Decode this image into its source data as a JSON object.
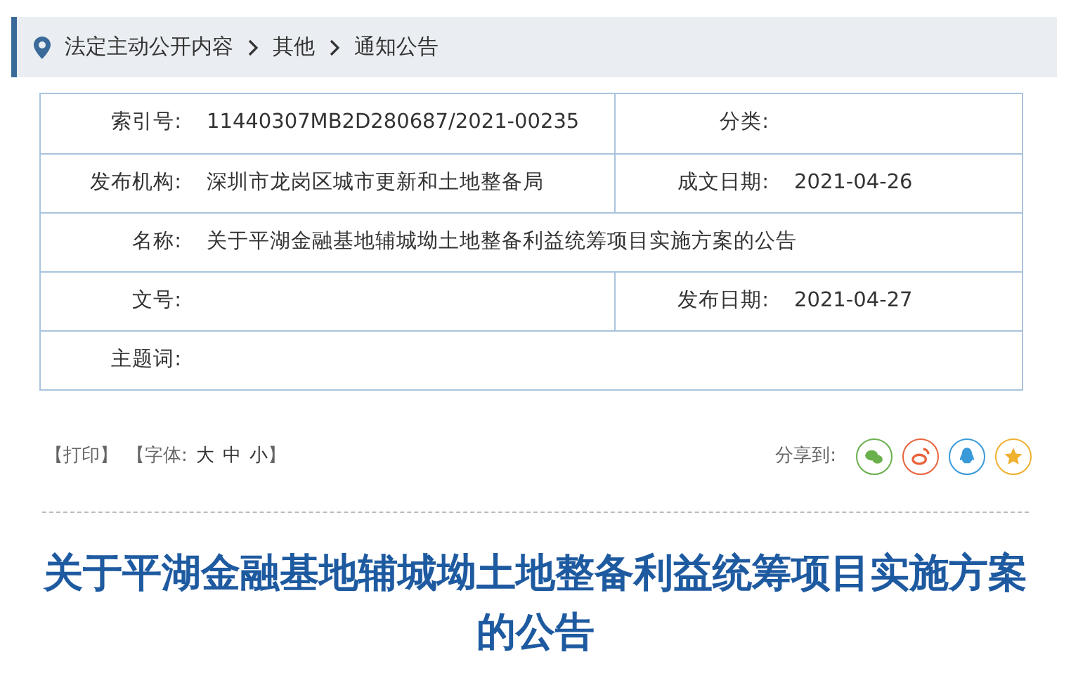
{
  "breadcrumb": [
    "法定主动公开内容",
    "其他",
    "通知公告"
  ],
  "info_rows": [
    {
      "cells": [
        {
          "label": "索引号:",
          "value": "11440307MB2D280687/2021-00235"
        },
        {
          "label": "分类:"
        }
      ]
    },
    {
      "cells": [
        {
          "label": "发布机构:",
          "value": "深圳市龙岗区城市更新和土地整备局"
        },
        {
          "label": "成文日期:",
          "value": "2021-04-26"
        }
      ]
    },
    {
      "cells": [
        {
          "label": "名称:",
          "value": "关于平湖金融基地辅城坳土地整备利益统筹项目实施方案的公告"
        }
      ]
    },
    {
      "cells": [
        {
          "label": "文号:"
        },
        {
          "label": "发布日期:",
          "value": "2021-04-27"
        }
      ]
    },
    {
      "cells": [
        {
          "label": "主题词:"
        }
      ]
    }
  ],
  "tools": {
    "print": "【打印】",
    "font_label": "【字体:",
    "font_sizes": [
      "大",
      "中",
      "小"
    ],
    "font_end": "】"
  },
  "share": {
    "label": "分享到:",
    "targets": [
      {
        "kind": "wechat",
        "color": "#6ab04c"
      },
      {
        "kind": "weibo",
        "color": "#e8643c"
      },
      {
        "kind": "qq",
        "color": "#3a9ad9"
      },
      {
        "kind": "favorite",
        "color": "#f0b030"
      }
    ]
  },
  "title": "关于平湖金融基地辅城坳土地整备利益统筹项目实施方案的公告"
}
